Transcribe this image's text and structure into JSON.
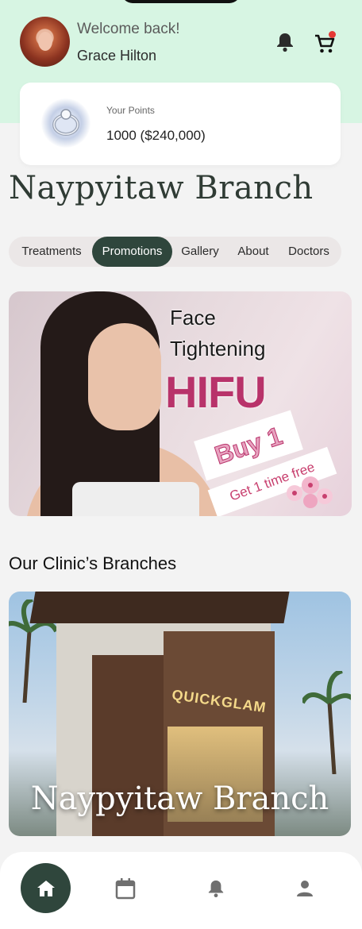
{
  "header": {
    "welcome_text": "Welcome back!",
    "user_name": "Grace Hilton",
    "icons": [
      "bell-icon",
      "cart-icon"
    ],
    "cart_has_notification": true
  },
  "points": {
    "label": "Your Points",
    "value": "1000 ($240,000)"
  },
  "branch": {
    "title": "Naypyitaw Branch"
  },
  "tabs": [
    {
      "label": "Treatments",
      "active": false
    },
    {
      "label": "Promotions",
      "active": true
    },
    {
      "label": "Gallery",
      "active": false
    },
    {
      "label": "About",
      "active": false
    },
    {
      "label": "Doctors",
      "active": false
    }
  ],
  "promo_banner": {
    "line1": "Face",
    "line2": "Tightening",
    "headline": "HIFU",
    "badge": "Buy 1",
    "offer": "Get 1 time free"
  },
  "branches_section": {
    "title": "Our Clinic’s Branches",
    "cards": [
      {
        "name": "Naypyitaw Branch",
        "sign": "QUICKGLAM"
      }
    ]
  },
  "bottom_nav": [
    {
      "icon": "home-icon",
      "active": true
    },
    {
      "icon": "calendar-icon",
      "active": false
    },
    {
      "icon": "bell-icon",
      "active": false
    },
    {
      "icon": "profile-icon",
      "active": false
    }
  ],
  "colors": {
    "header_bg": "#d7f5e3",
    "accent": "#2f463c",
    "promo_pink": "#b8336a",
    "notification_dot": "#e53935"
  }
}
